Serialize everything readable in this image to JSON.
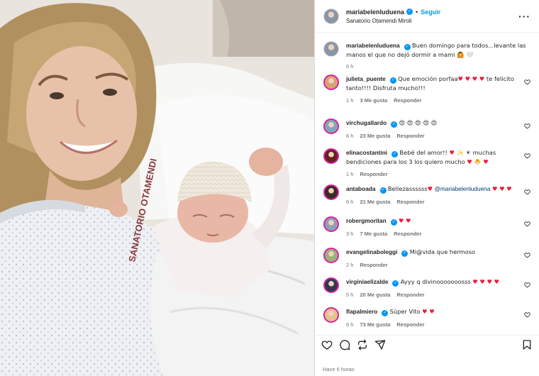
{
  "post": {
    "username": "mariabelenluduena",
    "follow_label": "Seguir",
    "location": "Sanatorio Otamendi Miroli",
    "photo_text": "SANATORIO OTAMENDI",
    "caption_text": "Buen domingo para todos...levante las manos el que no dejó dormir a mami 🙆 🤍",
    "caption_time": "6 h",
    "posted_ago": "Hace 6 horas"
  },
  "comments": [
    {
      "user": "julieta_puente",
      "text": "Que emoción porfaa♥ ♥ ♥ ♥  te felicito tanto!!!! Disfruta mucho!!!",
      "time": "1 h",
      "likes": "3 Me gusta",
      "reply": "Responder",
      "avatar": "#d9a070"
    },
    {
      "user": "virchugallardo",
      "text": "😍 😍 😍 😍 😍",
      "time": "6 h",
      "likes": "23 Me gusta",
      "reply": "Responder",
      "avatar": "#7fa8b8"
    },
    {
      "user": "elinacostantini",
      "text": "Bebé del amor!! ♥ ✨ ☀ muchas bendiciones para los 3 los quiero mucho ♥ 🐣 ♥",
      "time": "1 h",
      "likes": "",
      "reply": "Responder",
      "avatar": "#6b1f1f"
    },
    {
      "user": "antaboada",
      "text": "Bellezassssss♥",
      "mention": "@mariabelenluduena",
      "text_after": " ♥ ♥ ♥",
      "time": "6 h",
      "likes": "21 Me gusta",
      "reply": "Responder",
      "avatar": "#3a2a24"
    },
    {
      "user": "robergmoritan",
      "text": "♥ ♥",
      "time": "3 h",
      "likes": "7 Me gusta",
      "reply": "Responder",
      "avatar": "#8ea0b5"
    },
    {
      "user": "evangelinaboleggi",
      "text": "Mi@vida que hermoso",
      "time": "2 h",
      "likes": "",
      "reply": "Responder",
      "avatar": "#9bb07a"
    },
    {
      "user": "virginiaelizalde",
      "text": "Ayyy q divinooooooosss ♥ ♥ ♥ ♥",
      "time": "5 h",
      "likes": "20 Me gusta",
      "reply": "Responder",
      "avatar": "#2e3a4a"
    },
    {
      "user": "flapalmiero",
      "text": "Súper Vito ♥ ♥",
      "time": "6 h",
      "likes": "73 Me gusta",
      "reply": "Responder",
      "avatar": "#e6c38a"
    }
  ]
}
